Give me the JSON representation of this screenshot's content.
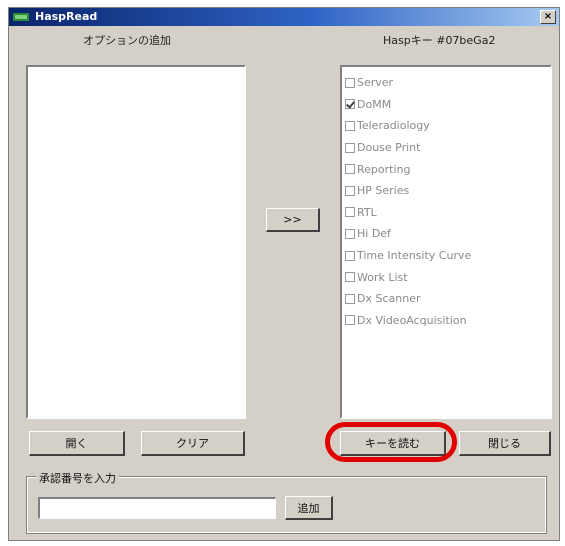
{
  "window": {
    "title": "HaspRead",
    "close_glyph": "×",
    "app_icon": "hasp-app-icon"
  },
  "left_panel": {
    "label": "オプションの追加",
    "items": []
  },
  "right_panel": {
    "label": "Haspキー #07beGa2",
    "items": [
      {
        "label": "Server",
        "checked": false
      },
      {
        "label": "DoMM",
        "checked": true
      },
      {
        "label": "Teleradiology",
        "checked": false
      },
      {
        "label": "Douse Print",
        "checked": false
      },
      {
        "label": "Reporting",
        "checked": false
      },
      {
        "label": "HP Series",
        "checked": false
      },
      {
        "label": "RTL",
        "checked": false
      },
      {
        "label": "Hi Def",
        "checked": false
      },
      {
        "label": "Time Intensity Curve",
        "checked": false
      },
      {
        "label": "Work List",
        "checked": false
      },
      {
        "label": "Dx Scanner",
        "checked": false
      },
      {
        "label": "Dx VideoAcquisition",
        "checked": false
      }
    ]
  },
  "buttons": {
    "transfer": ">>",
    "open": "開く",
    "clear": "クリア",
    "read_key": "キーを読む",
    "close": "閉じる",
    "add": "追加"
  },
  "auth_group": {
    "legend": "承認番号を入力",
    "input_value": "",
    "input_placeholder": ""
  },
  "colors": {
    "dialog_bg": "#d4d0c8",
    "titlebar_start": "#0a246a",
    "titlebar_end": "#a6caf0",
    "highlight": "#e00000",
    "disabled_text": "#8a8a8a"
  }
}
